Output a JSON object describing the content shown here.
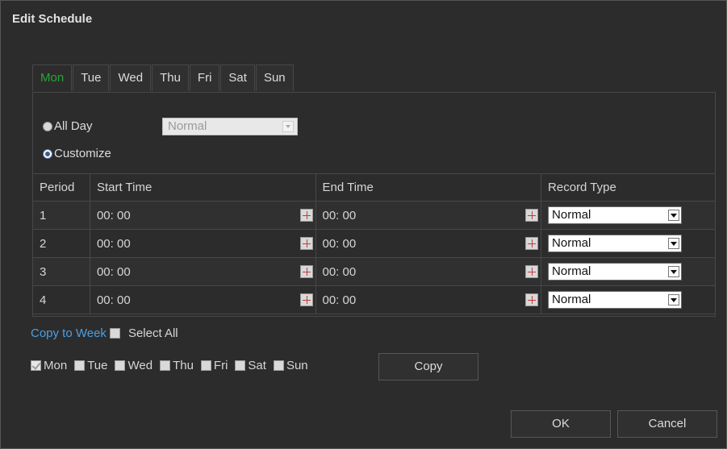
{
  "dialog": {
    "title": "Edit Schedule"
  },
  "tabs": [
    {
      "label": "Mon",
      "active": true
    },
    {
      "label": "Tue",
      "active": false
    },
    {
      "label": "Wed",
      "active": false
    },
    {
      "label": "Thu",
      "active": false
    },
    {
      "label": "Fri",
      "active": false
    },
    {
      "label": "Sat",
      "active": false
    },
    {
      "label": "Sun",
      "active": false
    }
  ],
  "mode": {
    "all_day_label": "All Day",
    "all_day_selected": false,
    "all_day_type": "Normal",
    "customize_label": "Customize",
    "customize_selected": true
  },
  "table": {
    "headers": {
      "period": "Period",
      "start": "Start Time",
      "end": "End Time",
      "record": "Record Type"
    },
    "rows": [
      {
        "period": "1",
        "start": "00: 00",
        "end": "00: 00",
        "record": "Normal"
      },
      {
        "period": "2",
        "start": "00: 00",
        "end": "00: 00",
        "record": "Normal"
      },
      {
        "period": "3",
        "start": "00: 00",
        "end": "00: 00",
        "record": "Normal"
      },
      {
        "period": "4",
        "start": "00: 00",
        "end": "00: 00",
        "record": "Normal"
      }
    ]
  },
  "copy": {
    "copy_to_week": "Copy to Week",
    "select_all": "Select All",
    "select_all_checked": false,
    "days": [
      {
        "label": "Mon",
        "checked": true
      },
      {
        "label": "Tue",
        "checked": false
      },
      {
        "label": "Wed",
        "checked": false
      },
      {
        "label": "Thu",
        "checked": false
      },
      {
        "label": "Fri",
        "checked": false
      },
      {
        "label": "Sat",
        "checked": false
      },
      {
        "label": "Sun",
        "checked": false
      }
    ],
    "copy_button": "Copy"
  },
  "footer": {
    "ok": "OK",
    "cancel": "Cancel"
  },
  "colors": {
    "active_tab": "#2aa336",
    "link": "#4a9fe6",
    "background": "#2c2c2c"
  }
}
